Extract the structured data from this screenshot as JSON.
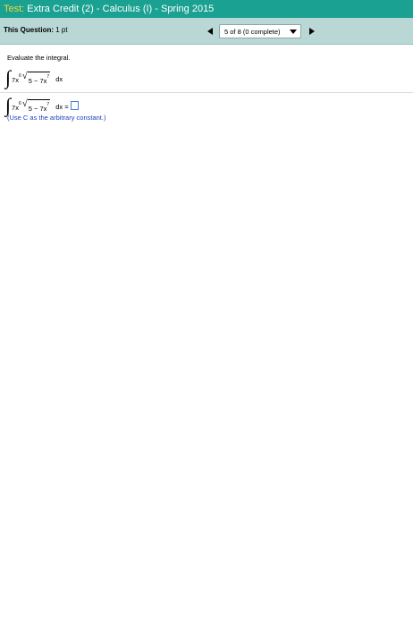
{
  "header": {
    "test_label": "Test:",
    "title": "Extra Credit (2) - Calculus (I) - Spring 2015"
  },
  "question_bar": {
    "label": "This Question:",
    "points": "1 pt",
    "selector_text": "5 of 8 (0 complete)"
  },
  "question": {
    "instruction": "Evaluate the integral.",
    "coef": "7x",
    "exp_6": "6",
    "radicand": "5 − 7x",
    "exp_7": "7",
    "dx": "dx",
    "dx_equals": "dx =",
    "hint": "(Use C as the arbitrary constant.)"
  },
  "colors": {
    "header_bg": "#1aa192",
    "test_label": "#f2d83a",
    "question_bar_bg": "#b9d8d5",
    "hint_text": "#1a3fbf",
    "answer_box_border": "#4a7fd9"
  },
  "icons": [
    "prev-arrow-icon",
    "next-arrow-icon",
    "dropdown-arrow-icon"
  ]
}
